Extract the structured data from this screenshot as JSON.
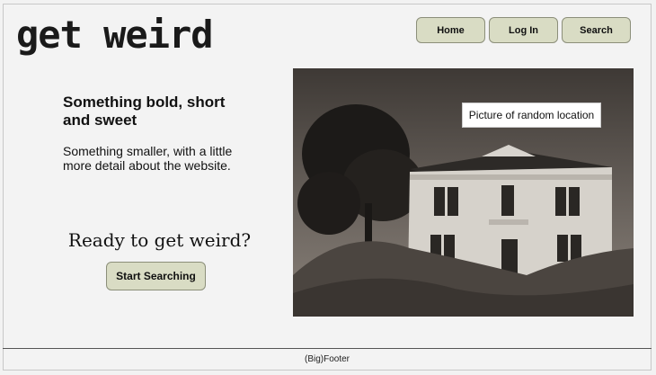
{
  "header": {
    "logo": "get weird",
    "nav": [
      {
        "label": "Home"
      },
      {
        "label": "Log In"
      },
      {
        "label": "Search"
      }
    ]
  },
  "main": {
    "headline": "Something bold, short and sweet",
    "subtext": "Something smaller, with a little more detail about the website.",
    "cta_title": "Ready to get weird?",
    "cta_button": "Start Searching",
    "image_caption": "Picture of random location"
  },
  "footer": {
    "text": "(Big)Footer"
  },
  "colors": {
    "button_bg": "#d9dcc4",
    "button_border": "#8c8f7a",
    "page_bg": "#f3f3f3"
  }
}
